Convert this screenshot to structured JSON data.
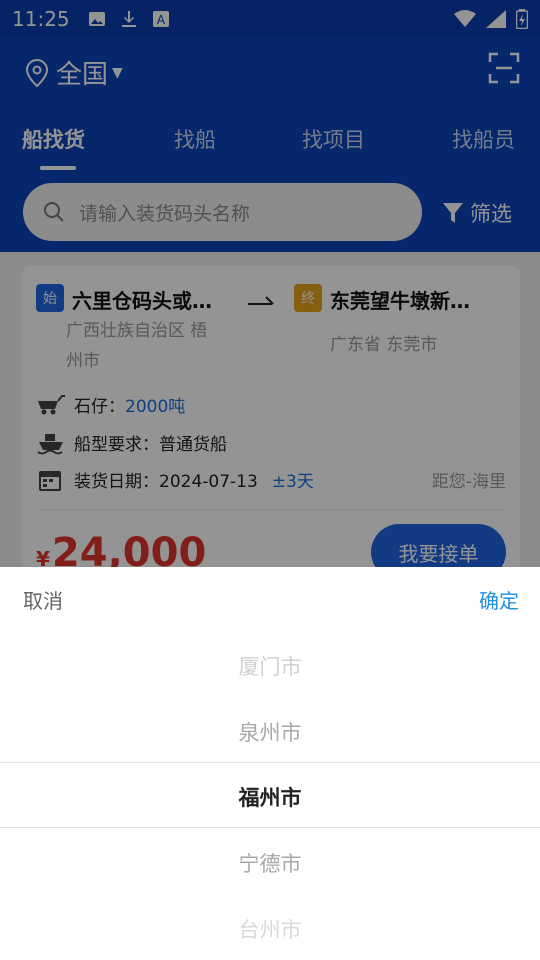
{
  "status_bar": {
    "time": "11:25"
  },
  "header": {
    "location": "全国",
    "tabs": [
      {
        "label": "船找货",
        "active": true
      },
      {
        "label": "找船"
      },
      {
        "label": "找项目"
      },
      {
        "label": "找船员"
      }
    ],
    "search_placeholder": "请输入装货码头名称",
    "filter_label": "筛选"
  },
  "card": {
    "start_badge": "始",
    "start_name": "六里仓码头或…",
    "start_region_line1": "广西壮族自治区 梧",
    "start_region_line2": "州市",
    "end_badge": "终",
    "end_name": "东莞望牛墩新…",
    "end_region": "广东省 东莞市",
    "cargo_label": "石仔：",
    "cargo_value": "2000吨",
    "ship_type": "船型要求：普通货船",
    "date_label": "装货日期：2024-07-13",
    "date_range": "±3天",
    "distance": "距您-海里",
    "price_currency": "¥",
    "price_value": "24,000",
    "accept_button": "我要接单"
  },
  "picker": {
    "cancel": "取消",
    "confirm": "确定",
    "options": [
      "厦门市",
      "泉州市",
      "福州市",
      "宁德市",
      "台州市"
    ],
    "selected": "福州市"
  },
  "colors": {
    "primary": "#0b44b8",
    "accent": "#1f67e3",
    "price": "#e0342c",
    "link": "#1f8fe0"
  }
}
